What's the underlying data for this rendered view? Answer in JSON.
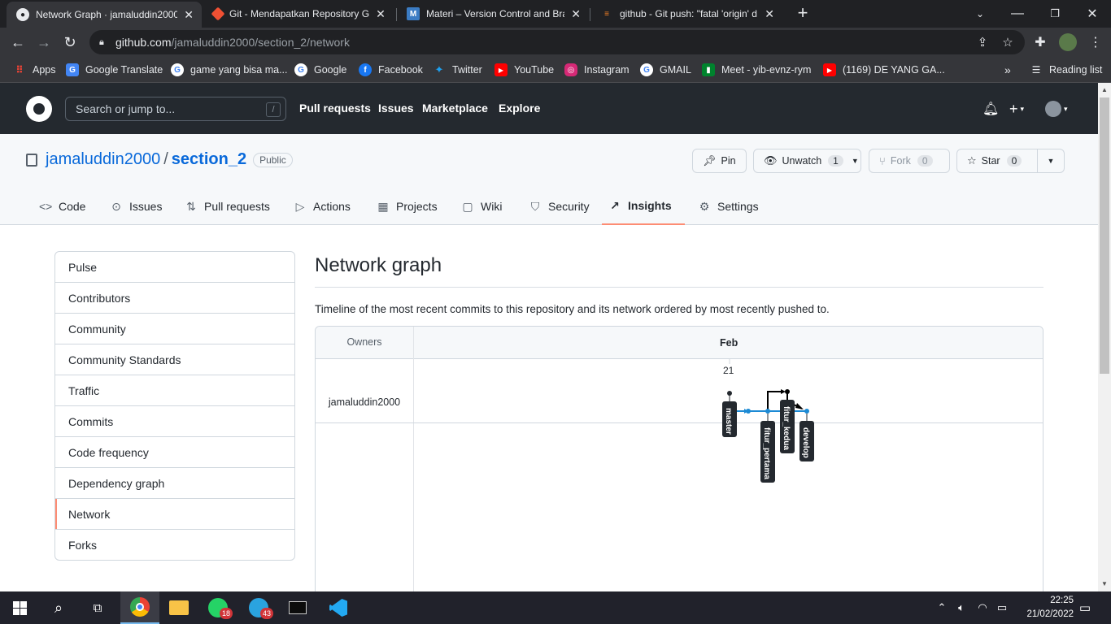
{
  "browser": {
    "tabs": [
      {
        "title": "Network Graph · jamaluddin2000",
        "icon": "github-icon",
        "active": true
      },
      {
        "title": "Git - Mendapatkan Repository Gi",
        "icon": "git-icon",
        "active": false
      },
      {
        "title": "Materi – Version Control and Bra",
        "icon": "m-icon",
        "active": false
      },
      {
        "title": "github - Git push: \"fatal 'origin' d",
        "icon": "stackoverflow-icon",
        "active": false
      }
    ],
    "url_host": "github.com",
    "url_path": "/jamaluddin2000/section_2/network",
    "bookmarks": [
      {
        "label": "Apps",
        "icon": "apps-grid-icon"
      },
      {
        "label": "Google Translate",
        "icon": "google-translate-icon"
      },
      {
        "label": "game yang bisa ma...",
        "icon": "google-icon"
      },
      {
        "label": "Google",
        "icon": "google-icon"
      },
      {
        "label": "Facebook",
        "icon": "facebook-icon"
      },
      {
        "label": "Twitter",
        "icon": "twitter-icon"
      },
      {
        "label": "YouTube",
        "icon": "youtube-icon"
      },
      {
        "label": "Instagram",
        "icon": "instagram-icon"
      },
      {
        "label": "GMAIL",
        "icon": "google-icon"
      },
      {
        "label": "Meet - yib-evnz-rym",
        "icon": "meet-icon"
      },
      {
        "label": "(1169) DE YANG GA...",
        "icon": "youtube-icon"
      }
    ],
    "reading_list": "Reading list",
    "more_bookmarks": "»"
  },
  "github_header": {
    "search_placeholder": "Search or jump to...",
    "search_key": "/",
    "nav": [
      "Pull requests",
      "Issues",
      "Marketplace",
      "Explore"
    ]
  },
  "repo": {
    "owner": "jamaluddin2000",
    "separator": "/",
    "name": "section_2",
    "visibility": "Public",
    "buttons": {
      "pin": "Pin",
      "unwatch": "Unwatch",
      "unwatch_count": "1",
      "fork": "Fork",
      "fork_count": "0",
      "star": "Star",
      "star_count": "0"
    },
    "tabs": [
      {
        "label": "Code",
        "icon": "code-icon"
      },
      {
        "label": "Issues",
        "icon": "issue-icon"
      },
      {
        "label": "Pull requests",
        "icon": "pull-request-icon"
      },
      {
        "label": "Actions",
        "icon": "play-icon"
      },
      {
        "label": "Projects",
        "icon": "table-icon"
      },
      {
        "label": "Wiki",
        "icon": "book-icon"
      },
      {
        "label": "Security",
        "icon": "shield-icon"
      },
      {
        "label": "Insights",
        "icon": "graph-icon",
        "active": true
      },
      {
        "label": "Settings",
        "icon": "gear-icon"
      }
    ]
  },
  "sidebar": {
    "items": [
      "Pulse",
      "Contributors",
      "Community",
      "Community Standards",
      "Traffic",
      "Commits",
      "Code frequency",
      "Dependency graph",
      "Network",
      "Forks"
    ],
    "selected": "Network"
  },
  "main": {
    "title": "Network graph",
    "description": "Timeline of the most recent commits to this repository and its network ordered by most recently pushed to."
  },
  "network_graph": {
    "owners_header": "Owners",
    "month": "Feb",
    "day": "21",
    "owner": "jamaluddin2000",
    "branches": [
      "master",
      "fitur_pertama",
      "fitur_kedua",
      "develop"
    ],
    "colors": {
      "main_line": "#1c8ad4",
      "branch_line": "#000000",
      "label_bg": "#24292f"
    }
  },
  "taskbar": {
    "whatsapp_badge": "18",
    "telegram_badge": "43",
    "time": "22:25",
    "date": "21/02/2022"
  },
  "colors": {
    "accent_tab": "#fd8c73",
    "link": "#0969da",
    "header_bg": "#24292f"
  }
}
